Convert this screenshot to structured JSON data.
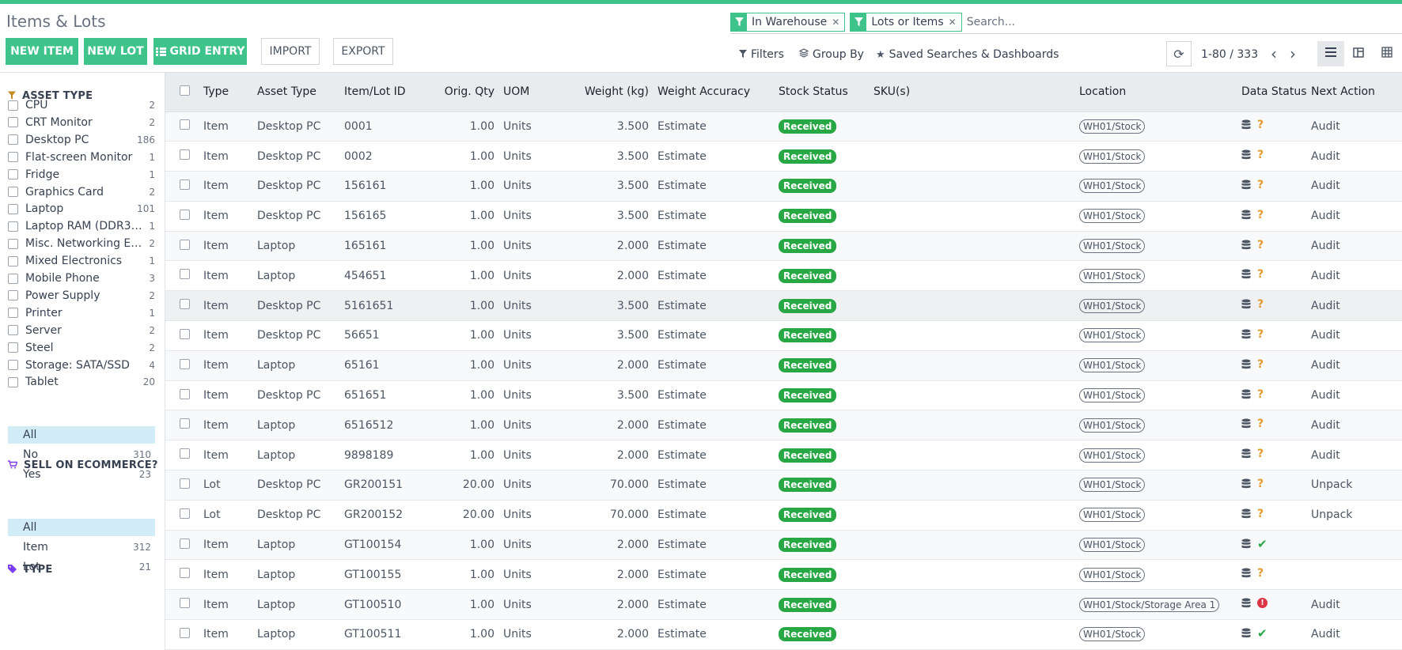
{
  "title": "Items & Lots",
  "search": {
    "facets": [
      {
        "label": "In Warehouse"
      },
      {
        "label": "Lots or Items"
      }
    ],
    "placeholder": "Search..."
  },
  "buttons": {
    "new_item": "NEW ITEM",
    "new_lot": "NEW LOT",
    "grid_entry": "GRID ENTRY",
    "import": "IMPORT",
    "export": "EXPORT"
  },
  "toolbar": {
    "filters": "Filters",
    "group_by": "Group By",
    "saved": "Saved Searches & Dashboards"
  },
  "pager": {
    "value": "1-80 / 333"
  },
  "sidebar": {
    "asset_type": {
      "heading": "ASSET TYPE",
      "items": [
        {
          "label": "CPU",
          "count": "2"
        },
        {
          "label": "CRT Monitor",
          "count": "2"
        },
        {
          "label": "Desktop PC",
          "count": "186"
        },
        {
          "label": "Flat-screen Monitor",
          "count": "1"
        },
        {
          "label": "Fridge",
          "count": "1"
        },
        {
          "label": "Graphics Card",
          "count": "2"
        },
        {
          "label": "Laptop",
          "count": "101"
        },
        {
          "label": "Laptop RAM (DDR3 S...",
          "count": "1"
        },
        {
          "label": "Misc. Networking Equ...",
          "count": "2"
        },
        {
          "label": "Mixed Electronics",
          "count": "1"
        },
        {
          "label": "Mobile Phone",
          "count": "3"
        },
        {
          "label": "Power Supply",
          "count": "2"
        },
        {
          "label": "Printer",
          "count": "1"
        },
        {
          "label": "Server",
          "count": "2"
        },
        {
          "label": "Steel",
          "count": "2"
        },
        {
          "label": "Storage: SATA/SSD",
          "count": "4"
        },
        {
          "label": "Tablet",
          "count": "20"
        }
      ]
    },
    "ecommerce": {
      "heading": "SELL ON ECOMMERCE?",
      "options": [
        {
          "label": "All",
          "count": ""
        },
        {
          "label": "No",
          "count": "310"
        },
        {
          "label": "Yes",
          "count": "23"
        }
      ]
    },
    "type": {
      "heading": "TYPE",
      "options": [
        {
          "label": "All",
          "count": ""
        },
        {
          "label": "Item",
          "count": "312"
        },
        {
          "label": "Lot",
          "count": "21"
        }
      ]
    }
  },
  "table": {
    "headers": {
      "type": "Type",
      "asset_type": "Asset Type",
      "id": "Item/Lot ID",
      "qty": "Orig. Qty",
      "uom": "UOM",
      "weight": "Weight (kg)",
      "accuracy": "Weight Accuracy",
      "stock": "Stock Status",
      "sku": "SKU(s)",
      "location": "Location",
      "data_status": "Data Status",
      "next_action": "Next Action"
    },
    "rows": [
      {
        "type": "Item",
        "asset": "Desktop PC",
        "id": "0001",
        "qty": "1.00",
        "uom": "Units",
        "weight": "3.500",
        "acc": "Estimate",
        "stock": "Received",
        "sku": "",
        "loc": "WH01/Stock",
        "ds": "question",
        "next": "Audit"
      },
      {
        "type": "Item",
        "asset": "Desktop PC",
        "id": "0002",
        "qty": "1.00",
        "uom": "Units",
        "weight": "3.500",
        "acc": "Estimate",
        "stock": "Received",
        "sku": "",
        "loc": "WH01/Stock",
        "ds": "question",
        "next": "Audit"
      },
      {
        "type": "Item",
        "asset": "Desktop PC",
        "id": "156161",
        "qty": "1.00",
        "uom": "Units",
        "weight": "3.500",
        "acc": "Estimate",
        "stock": "Received",
        "sku": "",
        "loc": "WH01/Stock",
        "ds": "question",
        "next": "Audit"
      },
      {
        "type": "Item",
        "asset": "Desktop PC",
        "id": "156165",
        "qty": "1.00",
        "uom": "Units",
        "weight": "3.500",
        "acc": "Estimate",
        "stock": "Received",
        "sku": "",
        "loc": "WH01/Stock",
        "ds": "question",
        "next": "Audit"
      },
      {
        "type": "Item",
        "asset": "Laptop",
        "id": "165161",
        "qty": "1.00",
        "uom": "Units",
        "weight": "2.000",
        "acc": "Estimate",
        "stock": "Received",
        "sku": "",
        "loc": "WH01/Stock",
        "ds": "question",
        "next": "Audit"
      },
      {
        "type": "Item",
        "asset": "Laptop",
        "id": "454651",
        "qty": "1.00",
        "uom": "Units",
        "weight": "2.000",
        "acc": "Estimate",
        "stock": "Received",
        "sku": "",
        "loc": "WH01/Stock",
        "ds": "question",
        "next": "Audit"
      },
      {
        "type": "Item",
        "asset": "Desktop PC",
        "id": "5161651",
        "qty": "1.00",
        "uom": "Units",
        "weight": "3.500",
        "acc": "Estimate",
        "stock": "Received",
        "sku": "",
        "loc": "WH01/Stock",
        "ds": "question",
        "next": "Audit"
      },
      {
        "type": "Item",
        "asset": "Desktop PC",
        "id": "56651",
        "qty": "1.00",
        "uom": "Units",
        "weight": "3.500",
        "acc": "Estimate",
        "stock": "Received",
        "sku": "",
        "loc": "WH01/Stock",
        "ds": "question",
        "next": "Audit"
      },
      {
        "type": "Item",
        "asset": "Laptop",
        "id": "65161",
        "qty": "1.00",
        "uom": "Units",
        "weight": "2.000",
        "acc": "Estimate",
        "stock": "Received",
        "sku": "",
        "loc": "WH01/Stock",
        "ds": "question",
        "next": "Audit"
      },
      {
        "type": "Item",
        "asset": "Desktop PC",
        "id": "651651",
        "qty": "1.00",
        "uom": "Units",
        "weight": "3.500",
        "acc": "Estimate",
        "stock": "Received",
        "sku": "",
        "loc": "WH01/Stock",
        "ds": "question",
        "next": "Audit"
      },
      {
        "type": "Item",
        "asset": "Laptop",
        "id": "6516512",
        "qty": "1.00",
        "uom": "Units",
        "weight": "2.000",
        "acc": "Estimate",
        "stock": "Received",
        "sku": "",
        "loc": "WH01/Stock",
        "ds": "question",
        "next": "Audit"
      },
      {
        "type": "Item",
        "asset": "Laptop",
        "id": "9898189",
        "qty": "1.00",
        "uom": "Units",
        "weight": "2.000",
        "acc": "Estimate",
        "stock": "Received",
        "sku": "",
        "loc": "WH01/Stock",
        "ds": "question",
        "next": "Audit"
      },
      {
        "type": "Lot",
        "asset": "Desktop PC",
        "id": "GR200151",
        "qty": "20.00",
        "uom": "Units",
        "weight": "70.000",
        "acc": "Estimate",
        "stock": "Received",
        "sku": "",
        "loc": "WH01/Stock",
        "ds": "question",
        "next": "Unpack"
      },
      {
        "type": "Lot",
        "asset": "Desktop PC",
        "id": "GR200152",
        "qty": "20.00",
        "uom": "Units",
        "weight": "70.000",
        "acc": "Estimate",
        "stock": "Received",
        "sku": "",
        "loc": "WH01/Stock",
        "ds": "question",
        "next": "Unpack"
      },
      {
        "type": "Item",
        "asset": "Laptop",
        "id": "GT100154",
        "qty": "1.00",
        "uom": "Units",
        "weight": "2.000",
        "acc": "Estimate",
        "stock": "Received",
        "sku": "",
        "loc": "WH01/Stock",
        "ds": "check",
        "next": ""
      },
      {
        "type": "Item",
        "asset": "Laptop",
        "id": "GT100155",
        "qty": "1.00",
        "uom": "Units",
        "weight": "2.000",
        "acc": "Estimate",
        "stock": "Received",
        "sku": "",
        "loc": "WH01/Stock",
        "ds": "question",
        "next": ""
      },
      {
        "type": "Item",
        "asset": "Laptop",
        "id": "GT100510",
        "qty": "1.00",
        "uom": "Units",
        "weight": "2.000",
        "acc": "Estimate",
        "stock": "Received",
        "sku": "",
        "loc": "WH01/Stock/Storage Area 1",
        "ds": "error",
        "next": "Audit"
      },
      {
        "type": "Item",
        "asset": "Laptop",
        "id": "GT100511",
        "qty": "1.00",
        "uom": "Units",
        "weight": "2.000",
        "acc": "Estimate",
        "stock": "Received",
        "sku": "",
        "loc": "WH01/Stock",
        "ds": "check",
        "next": "Audit"
      }
    ]
  },
  "colors": {
    "primary": "#3ec48a",
    "badge_green": "#28a745",
    "question": "#e49a2d",
    "error": "#dc3545"
  }
}
